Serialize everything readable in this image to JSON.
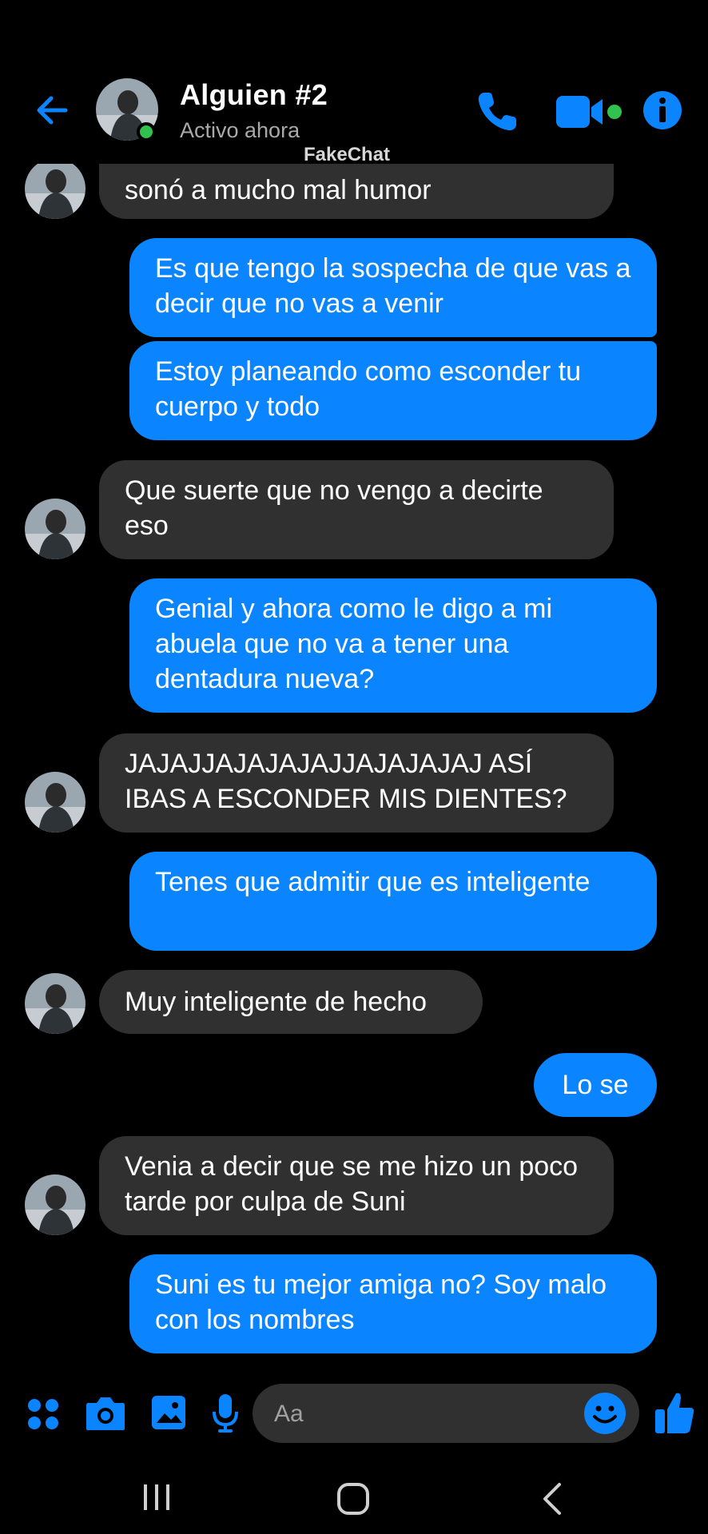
{
  "header": {
    "contact_name": "Alguien #2",
    "status": "Activo ahora",
    "watermark": "FakeChat"
  },
  "messages": [
    {
      "from": "them",
      "text": "sonó a mucho mal humor"
    },
    {
      "from": "me",
      "text": "Es que tengo la sospecha de que vas a decir que no vas a venir"
    },
    {
      "from": "me",
      "text": "Estoy planeando como esconder tu cuerpo y todo"
    },
    {
      "from": "them",
      "text": "Que suerte que no vengo a decirte eso"
    },
    {
      "from": "me",
      "text": "Genial y ahora como le digo a mi abuela que no va a tener una dentadura nueva?"
    },
    {
      "from": "them",
      "text": "JAJAJJAJAJAJAJJAJAJAJAJ ASÍ IBAS A ESCONDER MIS DIENTES?"
    },
    {
      "from": "me",
      "text": "Tenes que admitir que es inteligente"
    },
    {
      "from": "them",
      "text": "Muy inteligente de hecho"
    },
    {
      "from": "me",
      "text": "Lo se"
    },
    {
      "from": "them",
      "text": "Venia a decir que se me hizo un poco tarde por culpa de Suni"
    },
    {
      "from": "me",
      "text": "Suni es tu mejor amiga no? Soy malo con los nombres"
    }
  ],
  "composer": {
    "placeholder": "Aa"
  },
  "colors": {
    "accent": "#0a84ff",
    "incoming_bubble": "#303030",
    "online": "#31c24d"
  }
}
